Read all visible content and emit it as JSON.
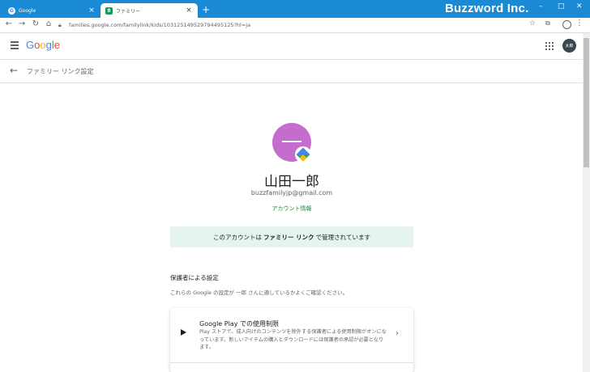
{
  "browser": {
    "tabs": [
      {
        "title": "Google",
        "favicon": "G",
        "close": "×"
      },
      {
        "title": "ファミリー",
        "favicon": "8",
        "close": "×"
      }
    ],
    "new_tab": "+",
    "brand": "Buzzword Inc.",
    "window_controls": {
      "minimize": "–",
      "maximize": "□",
      "close": "✕"
    },
    "nav": {
      "back": "←",
      "forward": "→",
      "reload": "↻",
      "home": "⌂"
    },
    "url": "families.google.com/familylink/kids/103125149529794495125?hl=ja",
    "colors": {
      "titlebar": "#1a8ad4"
    }
  },
  "header": {
    "logo_letters": [
      {
        "ch": "G",
        "color": "#4285f4"
      },
      {
        "ch": "o",
        "color": "#ea4335"
      },
      {
        "ch": "o",
        "color": "#fbbc05"
      },
      {
        "ch": "g",
        "color": "#4285f4"
      },
      {
        "ch": "l",
        "color": "#34a853"
      },
      {
        "ch": "e",
        "color": "#ea4335"
      }
    ],
    "avatar_label": "太郎"
  },
  "subheader": {
    "title": "ファミリー リンク設定"
  },
  "profile": {
    "name": "山田一郎",
    "email": "buzzfamilyjp@gmail.com",
    "account_link": "アカウント情報",
    "avatar_color": "#c56ccf"
  },
  "banner": {
    "prefix": "このアカウントは",
    "bold": "ファミリー リンク",
    "suffix": "で管理されています"
  },
  "section": {
    "title": "保護者による設定",
    "description": "これらの Google の設定が 一郎 さんに適しているかよくご確認ください。"
  },
  "card": {
    "title": "Google Play での使用制限",
    "description": "Play ストアで、成人向けのコンテンツを除外する保護者による使用制限がオンになっています。新しいアイテムの購入とダウンロードには保護者の承認が必要となります。",
    "chevron": "›"
  }
}
